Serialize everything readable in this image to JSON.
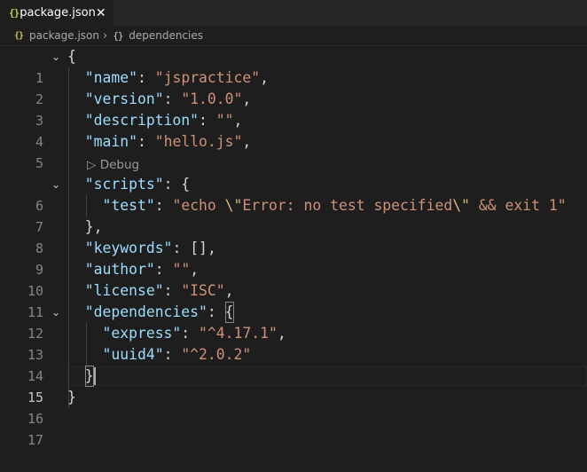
{
  "tab": {
    "icon_text": "{}",
    "label": "package.json",
    "close_glyph": "✕"
  },
  "breadcrumb": {
    "file_icon_text": "{}",
    "file": "package.json",
    "separator": "›",
    "node_icon_text": "{}",
    "node": "dependencies"
  },
  "codelens": {
    "icon": "▷",
    "label": "Debug"
  },
  "editor": {
    "active_line": 15,
    "lines": [
      {
        "n": "1",
        "fold": "⌄"
      },
      {
        "n": "2"
      },
      {
        "n": "3"
      },
      {
        "n": "4"
      },
      {
        "n": "5"
      },
      {
        "n": "6",
        "fold": "⌄"
      },
      {
        "n": "7"
      },
      {
        "n": "8"
      },
      {
        "n": "9"
      },
      {
        "n": "10"
      },
      {
        "n": "11"
      },
      {
        "n": "12",
        "fold": "⌄"
      },
      {
        "n": "13"
      },
      {
        "n": "14"
      },
      {
        "n": "15"
      },
      {
        "n": "16"
      },
      {
        "n": "17"
      }
    ],
    "tokens": {
      "l1": "{",
      "name_key": "\"name\"",
      "name_val": "\"jspractice\"",
      "version_key": "\"version\"",
      "version_val": "\"1.0.0\"",
      "description_key": "\"description\"",
      "description_val": "\"\"",
      "main_key": "\"main\"",
      "main_val": "\"hello.js\"",
      "scripts_key": "\"scripts\"",
      "test_key": "\"test\"",
      "test_val_a": "\"echo ",
      "test_esc_1": "\\\"",
      "test_val_b": "Error: no test specified",
      "test_esc_2": "\\\"",
      "test_val_c": " && exit 1\"",
      "scripts_close": "},",
      "keywords_key": "\"keywords\"",
      "keywords_val": "[]",
      "author_key": "\"author\"",
      "author_val": "\"\"",
      "license_key": "\"license\"",
      "license_val": "\"ISC\"",
      "dependencies_key": "\"dependencies\"",
      "express_key": "\"express\"",
      "express_val": "\"^4.17.1\"",
      "uuid_key": "\"uuid4\"",
      "uuid_val": "\"^2.0.2\"",
      "deps_close": "}",
      "root_close": "}"
    }
  }
}
